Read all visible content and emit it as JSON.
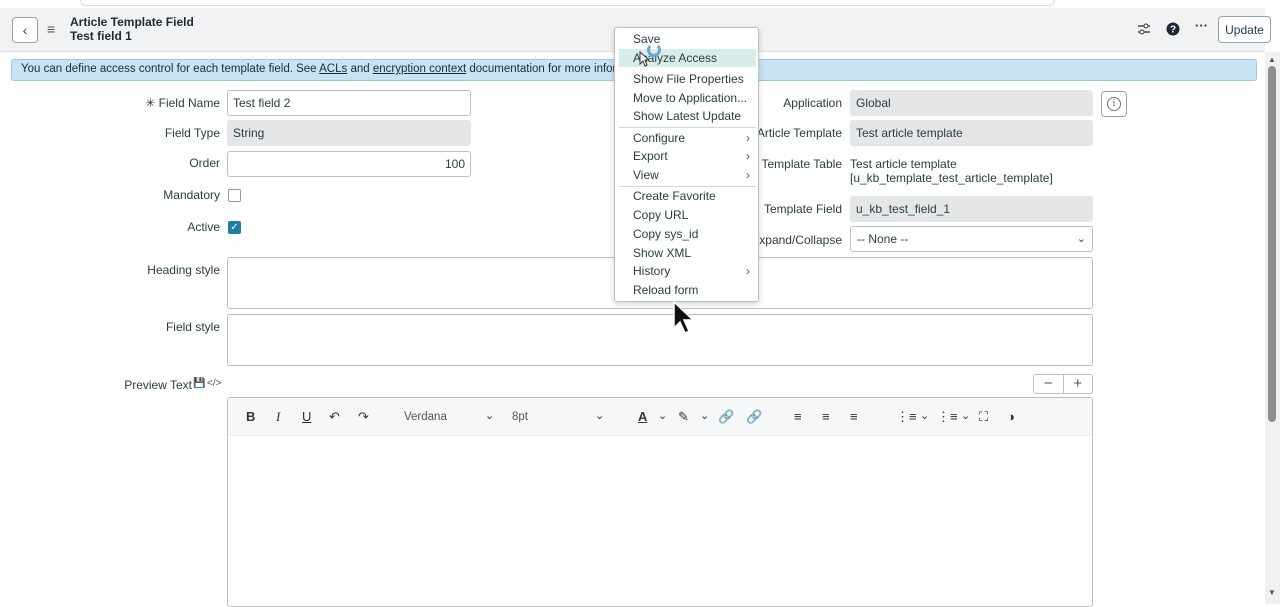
{
  "header": {
    "title": "Article Template Field",
    "subtitle": "Test field 1",
    "update_label": "Update",
    "icons": [
      "back-chevron-icon",
      "hamburger-menu-icon",
      "attachments-settings-icon",
      "help-icon",
      "more-options-icon"
    ]
  },
  "info_bar": {
    "text_before": "You can define access control for each template field. See ",
    "acl_link": "ACLs",
    "text_and": " and ",
    "encryption_link": "encryption context",
    "text_after": " documentation for more informat"
  },
  "form": {
    "field_name": {
      "label": "Field Name",
      "value": "Test field 2",
      "required_marker": "✳"
    },
    "field_type": {
      "label": "Field Type",
      "value": "String"
    },
    "order": {
      "label": "Order",
      "value": "100"
    },
    "mandatory": {
      "label": "Mandatory",
      "checked": false
    },
    "active": {
      "label": "Active",
      "checked": true
    },
    "heading_style": {
      "label": "Heading style",
      "value": ""
    },
    "field_style": {
      "label": "Field style",
      "value": ""
    },
    "preview_text": {
      "label": "Preview Text"
    },
    "application": {
      "label": "Application",
      "value": "Global"
    },
    "article_template": {
      "label": "Article Template",
      "value": "Test article template"
    },
    "template_table": {
      "label": "Template Table",
      "line1": "Test article template",
      "line2": "[u_kb_template_test_article_template]"
    },
    "template_field": {
      "label": "Template Field",
      "value": "u_kb_test_field_1"
    },
    "expand_collapse": {
      "label": "Expand/Collapse",
      "value": "-- None --"
    }
  },
  "editor": {
    "font_family": "Verdana",
    "font_size": "8pt",
    "minus": "−",
    "plus": "+"
  },
  "context_menu": {
    "items": [
      {
        "label": "Save",
        "submenu": false
      },
      {
        "label": "Analyze Access",
        "submenu": false,
        "highlighted": true
      },
      {
        "label": "Show File Properties",
        "submenu": false
      },
      {
        "label": "Move to Application...",
        "submenu": false
      },
      {
        "label": "Show Latest Update",
        "submenu": false
      },
      {
        "label": "Configure",
        "submenu": true
      },
      {
        "label": "Export",
        "submenu": true
      },
      {
        "label": "View",
        "submenu": true
      },
      {
        "label": "Create Favorite",
        "submenu": false
      },
      {
        "label": "Copy URL",
        "submenu": false
      },
      {
        "label": "Copy sys_id",
        "submenu": false
      },
      {
        "label": "Show XML",
        "submenu": false
      },
      {
        "label": "History",
        "submenu": true
      },
      {
        "label": "Reload form",
        "submenu": false
      }
    ]
  }
}
